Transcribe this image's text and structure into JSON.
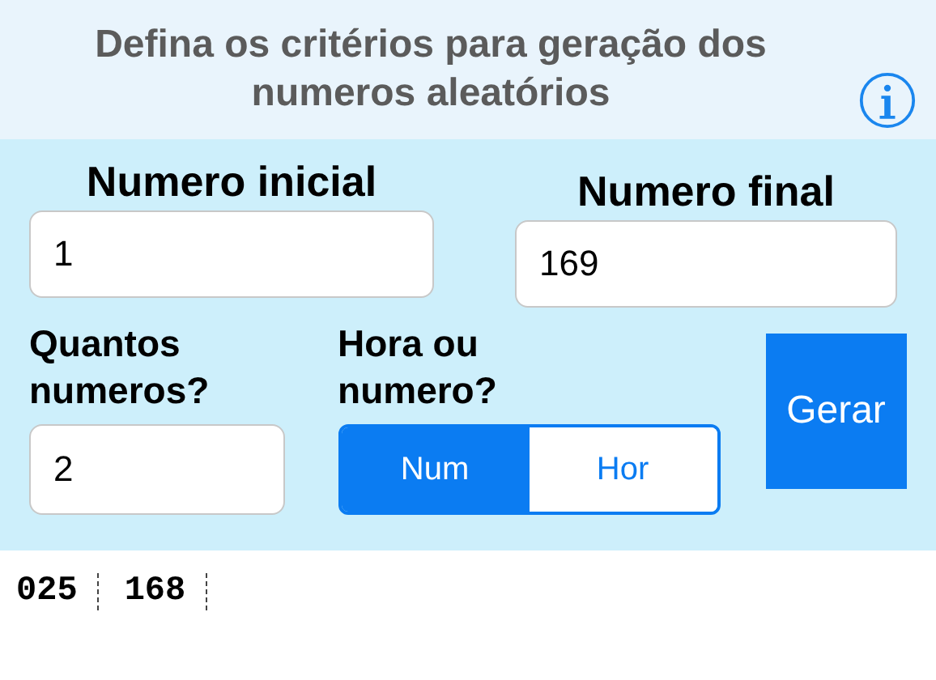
{
  "header": {
    "title": "Defina os critérios para geração dos numeros aleatórios"
  },
  "start": {
    "label": "Numero inicial",
    "value": "1"
  },
  "end": {
    "label": "Numero final",
    "value": "169"
  },
  "count": {
    "label": "Quantos numeros?",
    "value": "2"
  },
  "mode": {
    "label": "Hora ou numero?",
    "options": [
      {
        "label": "Num",
        "selected": true
      },
      {
        "label": "Hor",
        "selected": false
      }
    ]
  },
  "generate_button": "Gerar",
  "results": [
    "025",
    "168"
  ]
}
